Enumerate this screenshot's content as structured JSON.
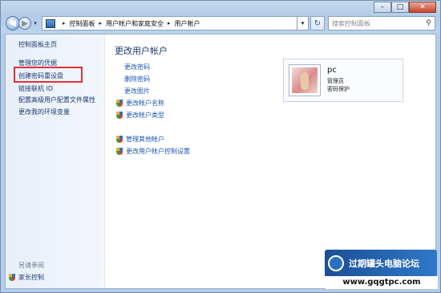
{
  "window": {
    "min_label": "–",
    "max_label": "□",
    "close_label": "✕"
  },
  "nav": {
    "back_glyph": "◀",
    "forward_glyph": "▶",
    "drop_glyph": "▾",
    "breadcrumbs": [
      "控制面板",
      "用户帐户和家庭安全",
      "用户帐户"
    ],
    "sep": "▸",
    "refresh_glyph": "↻",
    "search_placeholder": "搜索控制面板",
    "search_icon": "search-icon"
  },
  "sidebar": {
    "items": [
      {
        "label": "控制面板主页"
      },
      {
        "label": "管理您的凭据"
      },
      {
        "label": "创建密码重设盘"
      },
      {
        "label": "链接联机 ID"
      },
      {
        "label": "配置高级用户配置文件属性"
      },
      {
        "label": "更改我的环境变量"
      }
    ],
    "see_also": "另请参阅",
    "family": "家长控制"
  },
  "main": {
    "title": "更改用户帐户",
    "tasks_plain": [
      {
        "label": "更改密码"
      },
      {
        "label": "删除密码"
      },
      {
        "label": "更改图片"
      }
    ],
    "tasks_shield_1": [
      {
        "label": "更改帐户名称"
      },
      {
        "label": "更改帐户类型"
      }
    ],
    "tasks_shield_2": [
      {
        "label": "管理其他帐户"
      },
      {
        "label": "更改用户帐户控制设置"
      }
    ]
  },
  "account": {
    "name": "pc",
    "role": "管理员",
    "status": "密码保护"
  },
  "watermark": {
    "text": "过期罐头电脑论坛",
    "url": "www.gqgtpc.com"
  },
  "colors": {
    "link": "#1a55b0",
    "highlight_box": "#e0303a"
  }
}
